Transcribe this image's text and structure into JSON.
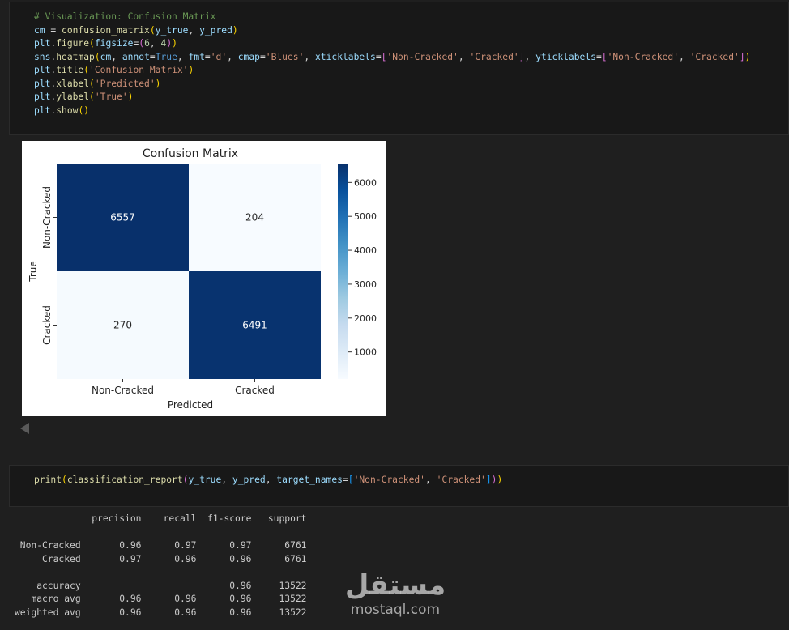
{
  "notebook": {
    "cell1": {
      "lines": [
        [
          {
            "t": "# Visualization: Confusion Matrix",
            "c": "cm"
          }
        ],
        [
          {
            "t": "cm",
            "c": "vr"
          },
          {
            "t": " = ",
            "c": "pn"
          },
          {
            "t": "confusion_matrix",
            "c": "fn"
          },
          {
            "t": "(",
            "c": "br1"
          },
          {
            "t": "y_true",
            "c": "vr"
          },
          {
            "t": ", ",
            "c": "pn"
          },
          {
            "t": "y_pred",
            "c": "vr"
          },
          {
            "t": ")",
            "c": "br1"
          }
        ],
        [
          {
            "t": "plt",
            "c": "vr"
          },
          {
            "t": ".",
            "c": "pn"
          },
          {
            "t": "figure",
            "c": "fn"
          },
          {
            "t": "(",
            "c": "br1"
          },
          {
            "t": "figsize",
            "c": "vr"
          },
          {
            "t": "=",
            "c": "pn"
          },
          {
            "t": "(",
            "c": "br2"
          },
          {
            "t": "6",
            "c": "nm"
          },
          {
            "t": ", ",
            "c": "pn"
          },
          {
            "t": "4",
            "c": "nm"
          },
          {
            "t": ")",
            "c": "br2"
          },
          {
            "t": ")",
            "c": "br1"
          }
        ],
        [
          {
            "t": "sns",
            "c": "vr"
          },
          {
            "t": ".",
            "c": "pn"
          },
          {
            "t": "heatmap",
            "c": "fn"
          },
          {
            "t": "(",
            "c": "br1"
          },
          {
            "t": "cm",
            "c": "vr"
          },
          {
            "t": ", ",
            "c": "pn"
          },
          {
            "t": "annot",
            "c": "vr"
          },
          {
            "t": "=",
            "c": "pn"
          },
          {
            "t": "True",
            "c": "kw"
          },
          {
            "t": ", ",
            "c": "pn"
          },
          {
            "t": "fmt",
            "c": "vr"
          },
          {
            "t": "=",
            "c": "pn"
          },
          {
            "t": "'d'",
            "c": "st"
          },
          {
            "t": ", ",
            "c": "pn"
          },
          {
            "t": "cmap",
            "c": "vr"
          },
          {
            "t": "=",
            "c": "pn"
          },
          {
            "t": "'Blues'",
            "c": "st"
          },
          {
            "t": ", ",
            "c": "pn"
          },
          {
            "t": "xticklabels",
            "c": "vr"
          },
          {
            "t": "=",
            "c": "pn"
          },
          {
            "t": "[",
            "c": "br2"
          },
          {
            "t": "'Non-Cracked'",
            "c": "st"
          },
          {
            "t": ", ",
            "c": "pn"
          },
          {
            "t": "'Cracked'",
            "c": "st"
          },
          {
            "t": "]",
            "c": "br2"
          },
          {
            "t": ", ",
            "c": "pn"
          },
          {
            "t": "yticklabels",
            "c": "vr"
          },
          {
            "t": "=",
            "c": "pn"
          },
          {
            "t": "[",
            "c": "br2"
          },
          {
            "t": "'Non-Cracked'",
            "c": "st"
          },
          {
            "t": ", ",
            "c": "pn"
          },
          {
            "t": "'Cracked'",
            "c": "st"
          },
          {
            "t": "]",
            "c": "br2"
          },
          {
            "t": ")",
            "c": "br1"
          }
        ],
        [
          {
            "t": "plt",
            "c": "vr"
          },
          {
            "t": ".",
            "c": "pn"
          },
          {
            "t": "title",
            "c": "fn"
          },
          {
            "t": "(",
            "c": "br1"
          },
          {
            "t": "'Confusion Matrix'",
            "c": "st"
          },
          {
            "t": ")",
            "c": "br1"
          }
        ],
        [
          {
            "t": "plt",
            "c": "vr"
          },
          {
            "t": ".",
            "c": "pn"
          },
          {
            "t": "xlabel",
            "c": "fn"
          },
          {
            "t": "(",
            "c": "br1"
          },
          {
            "t": "'Predicted'",
            "c": "st"
          },
          {
            "t": ")",
            "c": "br1"
          }
        ],
        [
          {
            "t": "plt",
            "c": "vr"
          },
          {
            "t": ".",
            "c": "pn"
          },
          {
            "t": "ylabel",
            "c": "fn"
          },
          {
            "t": "(",
            "c": "br1"
          },
          {
            "t": "'True'",
            "c": "st"
          },
          {
            "t": ")",
            "c": "br1"
          }
        ],
        [
          {
            "t": "plt",
            "c": "vr"
          },
          {
            "t": ".",
            "c": "pn"
          },
          {
            "t": "show",
            "c": "fn"
          },
          {
            "t": "()",
            "c": "br1"
          }
        ]
      ]
    },
    "cell2": {
      "lines": [
        [
          {
            "t": "print",
            "c": "fn"
          },
          {
            "t": "(",
            "c": "br1"
          },
          {
            "t": "classification_report",
            "c": "fn"
          },
          {
            "t": "(",
            "c": "br2"
          },
          {
            "t": "y_true",
            "c": "vr"
          },
          {
            "t": ", ",
            "c": "pn"
          },
          {
            "t": "y_pred",
            "c": "vr"
          },
          {
            "t": ", ",
            "c": "pn"
          },
          {
            "t": "target_names",
            "c": "vr"
          },
          {
            "t": "=",
            "c": "pn"
          },
          {
            "t": "[",
            "c": "br3"
          },
          {
            "t": "'Non-Cracked'",
            "c": "st"
          },
          {
            "t": ", ",
            "c": "pn"
          },
          {
            "t": "'Cracked'",
            "c": "st"
          },
          {
            "t": "]",
            "c": "br3"
          },
          {
            "t": ")",
            "c": "br2"
          },
          {
            "t": ")",
            "c": "br1"
          }
        ]
      ]
    },
    "report_lines": [
      "              precision    recall  f1-score   support",
      "",
      " Non-Cracked       0.96      0.97      0.97      6761",
      "     Cracked       0.97      0.96      0.96      6761",
      "",
      "    accuracy                           0.96     13522",
      "   macro avg       0.96      0.96      0.96     13522",
      "weighted avg       0.96      0.96      0.96     13522"
    ],
    "watermark": {
      "arabic": "مستقل",
      "latin": "mostaql.com"
    }
  },
  "chart_data": {
    "type": "heatmap",
    "title": "Confusion Matrix",
    "xlabel": "Predicted",
    "ylabel": "True",
    "xticklabels": [
      "Non-Cracked",
      "Cracked"
    ],
    "yticklabels": [
      "Non-Cracked",
      "Cracked"
    ],
    "values": [
      [
        6557,
        204
      ],
      [
        270,
        6491
      ]
    ],
    "colormap": "Blues",
    "colorbar": {
      "ticks": [
        1000,
        2000,
        3000,
        4000,
        5000,
        6000
      ],
      "range": [
        204,
        6557
      ]
    }
  }
}
